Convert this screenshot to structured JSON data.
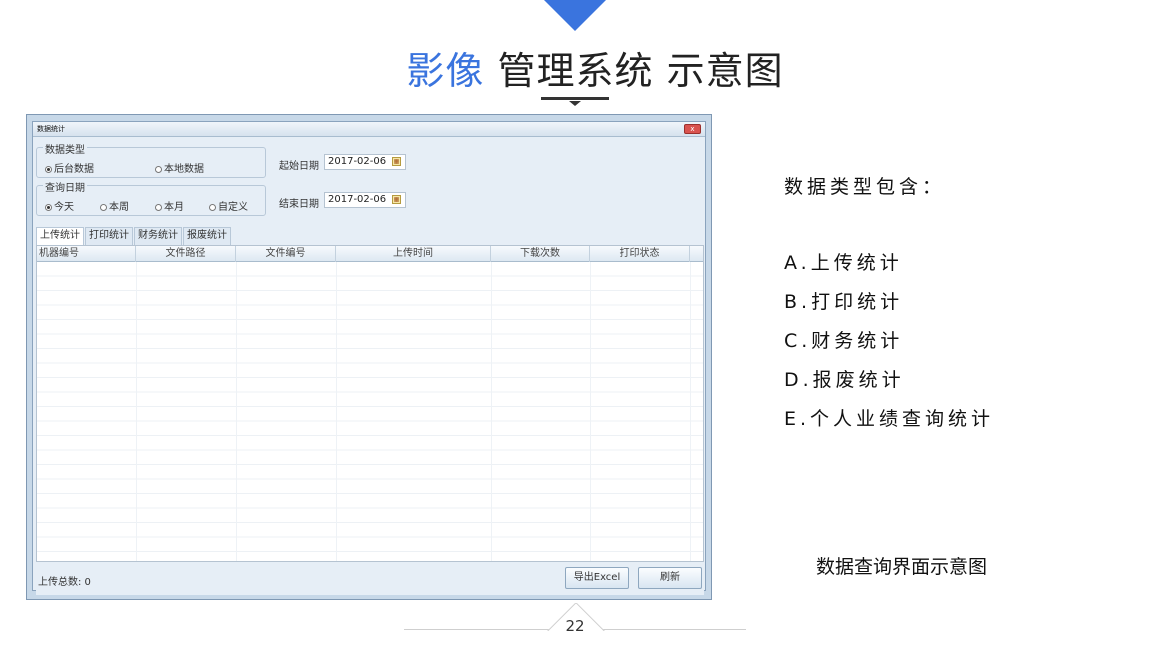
{
  "slide": {
    "title_accent": "影像",
    "title_rest": "管理系统 示意图",
    "page_number": "22",
    "caption": "数据查询界面示意图",
    "accent_color": "#3a74de"
  },
  "window": {
    "title": "数据统计",
    "close_label": "x",
    "data_type": {
      "legend": "数据类型",
      "options": [
        "后台数据",
        "本地数据"
      ],
      "selected": "后台数据"
    },
    "query_date": {
      "legend": "查询日期",
      "options": [
        "今天",
        "本周",
        "本月",
        "自定义"
      ],
      "selected": "今天"
    },
    "start_date_label": "起始日期",
    "start_date_value": "2017-02-06",
    "end_date_label": "结束日期",
    "end_date_value": "2017-02-06",
    "calendar_icon": "calendar-icon",
    "tabs": [
      "上传统计",
      "打印统计",
      "财务统计",
      "报废统计"
    ],
    "active_tab": "上传统计",
    "table_columns": [
      "机器编号",
      "文件路径",
      "文件编号",
      "上传时间",
      "下载次数",
      "打印状态"
    ],
    "status_text": "上传总数:  0",
    "export_button": "导出Excel",
    "refresh_button": "刷新"
  },
  "side": {
    "heading": "数据类型包含：",
    "items": [
      "A.上传统计",
      "B.打印统计",
      "C.财务统计",
      "D.报废统计",
      "E.个人业绩查询统计"
    ]
  }
}
